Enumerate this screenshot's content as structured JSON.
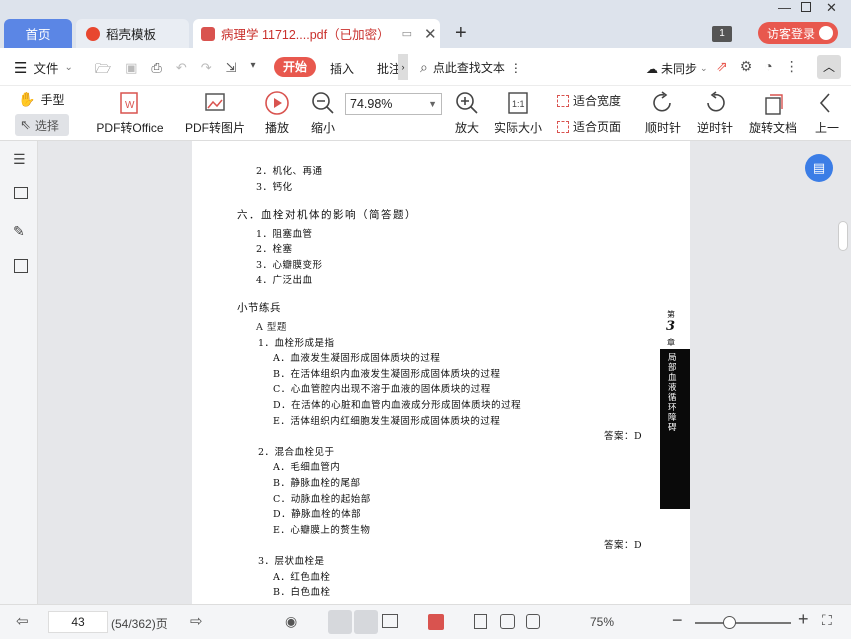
{
  "titlebar": {
    "home_tab": "首页",
    "daoke_tab": "稻壳模板",
    "pdf_tab": "病理学 11712....pdf（已加密）",
    "badge": "1",
    "login": "访客登录"
  },
  "menubar": {
    "file": "文件",
    "start": "开始",
    "insert": "插入",
    "annotate": "批注",
    "search": "点此查找文本",
    "sync": "未同步"
  },
  "ribbon": {
    "hand": "手型",
    "select": "选择",
    "pdf_office": "PDF转Office",
    "pdf_image": "PDF转图片",
    "play": "播放",
    "zoom_out": "缩小",
    "zoom_value": "74.98%",
    "zoom_in": "放大",
    "actual": "实际大小",
    "fit_width": "适合宽度",
    "fit_page": "适合页面",
    "rot_cw": "顺时针",
    "rot_ccw": "逆时针",
    "rotate_doc": "旋转文档",
    "prev": "上一"
  },
  "doc": {
    "l1": "2．机化、再通",
    "l2": "3．钙化",
    "s6": "六．血栓对机体的影响（简答题）",
    "s6_1": "1．阻塞血管",
    "s6_2": "2．栓塞",
    "s6_3": "3．心瓣膜变形",
    "s6_4": "4．广泛出血",
    "practice": "小节练兵",
    "atype": "A 型题",
    "q1": "1．血栓形成是指",
    "q1a": "A．血液发生凝固形成固体质块的过程",
    "q1b": "B．在活体组织内血液发生凝固形成固体质块的过程",
    "q1c": "C．心血管腔内出现不溶于血液的固体质块的过程",
    "q1d": "D．在活体的心脏和血管内血液成分形成固体质块的过程",
    "q1e": "E．活体组织内红细胞发生凝固形成固体质块的过程",
    "ans1": "答案：D",
    "q2": "2．混合血栓见于",
    "q2a": "A．毛细血管内",
    "q2b": "B．静脉血栓的尾部",
    "q2c": "C．动脉血栓的起始部",
    "q2d": "D．静脉血栓的体部",
    "q2e": "E．心瓣膜上的赘生物",
    "ans2": "答案：D",
    "q3": "3．层状血栓是",
    "q3a": "A．红色血栓",
    "q3b": "B．白色血栓",
    "side_top": "第",
    "side_num": "3",
    "side_ch": "章",
    "side_title": "局部血液循环障碍"
  },
  "status": {
    "page": "43",
    "page_info": "(54/362)页",
    "zoom": "75%"
  }
}
